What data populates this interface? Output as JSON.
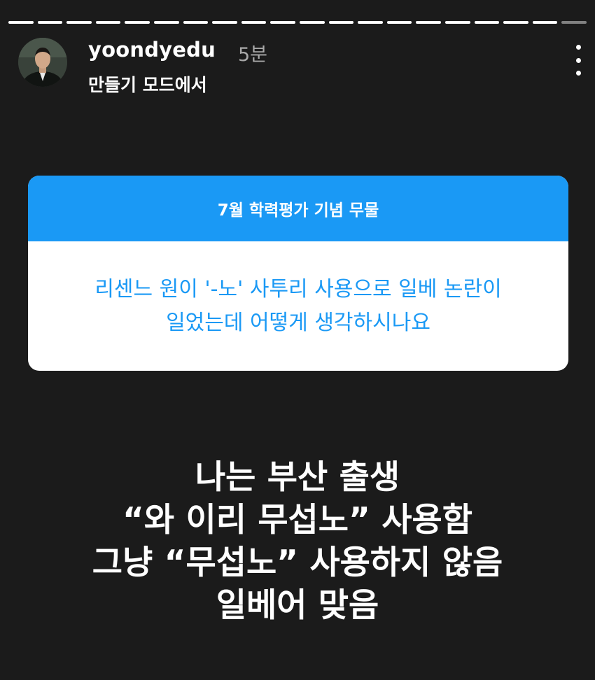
{
  "story": {
    "progress_segments": 20,
    "progress_completed": 19,
    "username": "yoondyedu",
    "timestamp": "5분",
    "subtitle": "만들기 모드에서",
    "more_icon": "more-vertical-icon"
  },
  "question_sticker": {
    "header": "7월 학력평가 기념 무물",
    "question_lines": [
      "리센느 원이 '-노' 사투리 사용으로 일베 논란이",
      "일었는데 어떻게 생각하시나요"
    ],
    "header_color": "#1a99f5",
    "text_color": "#1a99f5"
  },
  "answer": {
    "lines": [
      "나는 부산 출생",
      "“와 이리 무섭노” 사용함",
      "그냥 “무섭노” 사용하지 않음",
      "일베어 맞음"
    ]
  },
  "colors": {
    "background": "#1b1b1b",
    "timestamp": "#a9a9a9"
  }
}
